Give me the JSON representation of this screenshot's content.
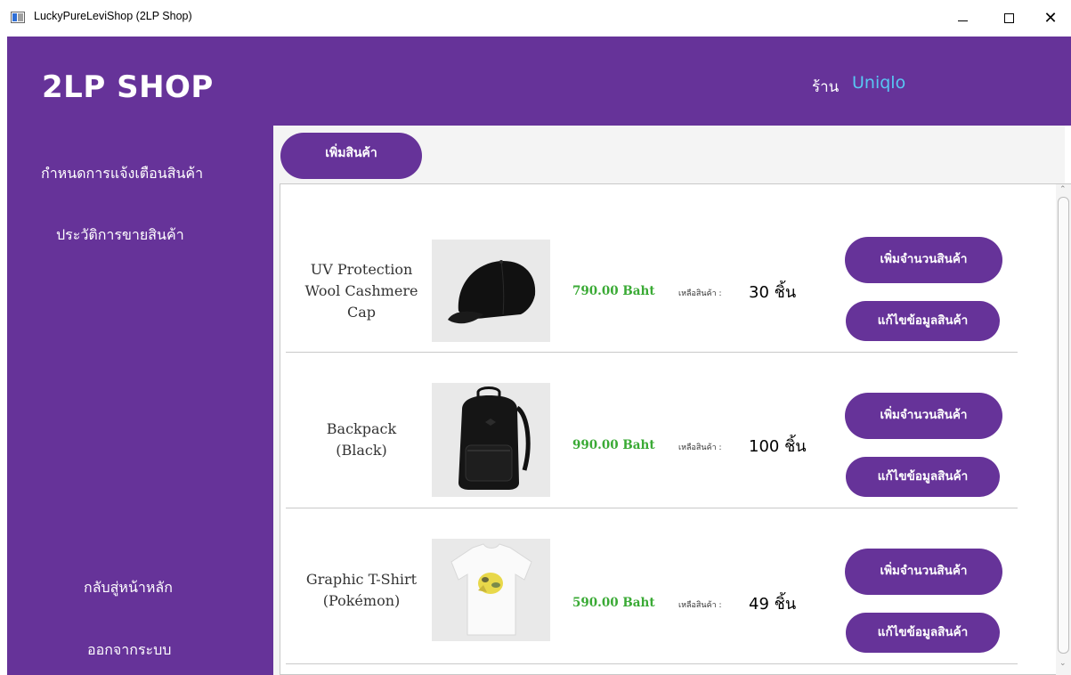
{
  "window": {
    "title": "LuckyPureLeviShop (2LP Shop)",
    "minimize_glyph": "",
    "maximize_glyph": "",
    "close_glyph": "✕"
  },
  "sidebar": {
    "brand": "2LP SHOP",
    "items": [
      {
        "label": "กำหนดการแจ้งเตือนสินค้า"
      },
      {
        "label": "ประวัติการขายสินค้า"
      },
      {
        "label": "กลับสู่หน้าหลัก"
      },
      {
        "label": "ออกจากระบบ"
      }
    ]
  },
  "header": {
    "shop_label": "ร้าน",
    "shop_name": "Uniqlo"
  },
  "main": {
    "add_product_label": "เพิ่มสินค้า"
  },
  "products": [
    {
      "name": "UV Protection\nWool Cashmere\nCap",
      "price": "790.00 Baht",
      "stock_label": "เหลือสินค้า :",
      "stock_qty": "30 ชิ้น",
      "increase_label": "เพิ่มจำนวนสินค้า",
      "edit_label": "แก้ไขข้อมูลสินค้า"
    },
    {
      "name": "Backpack\n(Black)",
      "price": "990.00 Baht",
      "stock_label": "เหลือสินค้า :",
      "stock_qty": "100 ชิ้น",
      "increase_label": "เพิ่มจำนวนสินค้า",
      "edit_label": "แก้ไขข้อมูลสินค้า"
    },
    {
      "name": "Graphic T-Shirt\n(Pokémon)",
      "price": "590.00 Baht",
      "stock_label": "เหลือสินค้า :",
      "stock_qty": "49 ชิ้น",
      "increase_label": "เพิ่มจำนวนสินค้า",
      "edit_label": "แก้ไขข้อมูลสินค้า"
    }
  ],
  "colors": {
    "primary": "#663399",
    "shop_name": "#58c7f3",
    "price": "#3aaa35",
    "content_bg": "#f4f4f4"
  },
  "icons": [
    "app-icon",
    "minimize-icon",
    "maximize-icon",
    "close-icon",
    "cap-image",
    "backpack-image",
    "tshirt-image",
    "scroll-up-icon",
    "scroll-down-icon"
  ]
}
